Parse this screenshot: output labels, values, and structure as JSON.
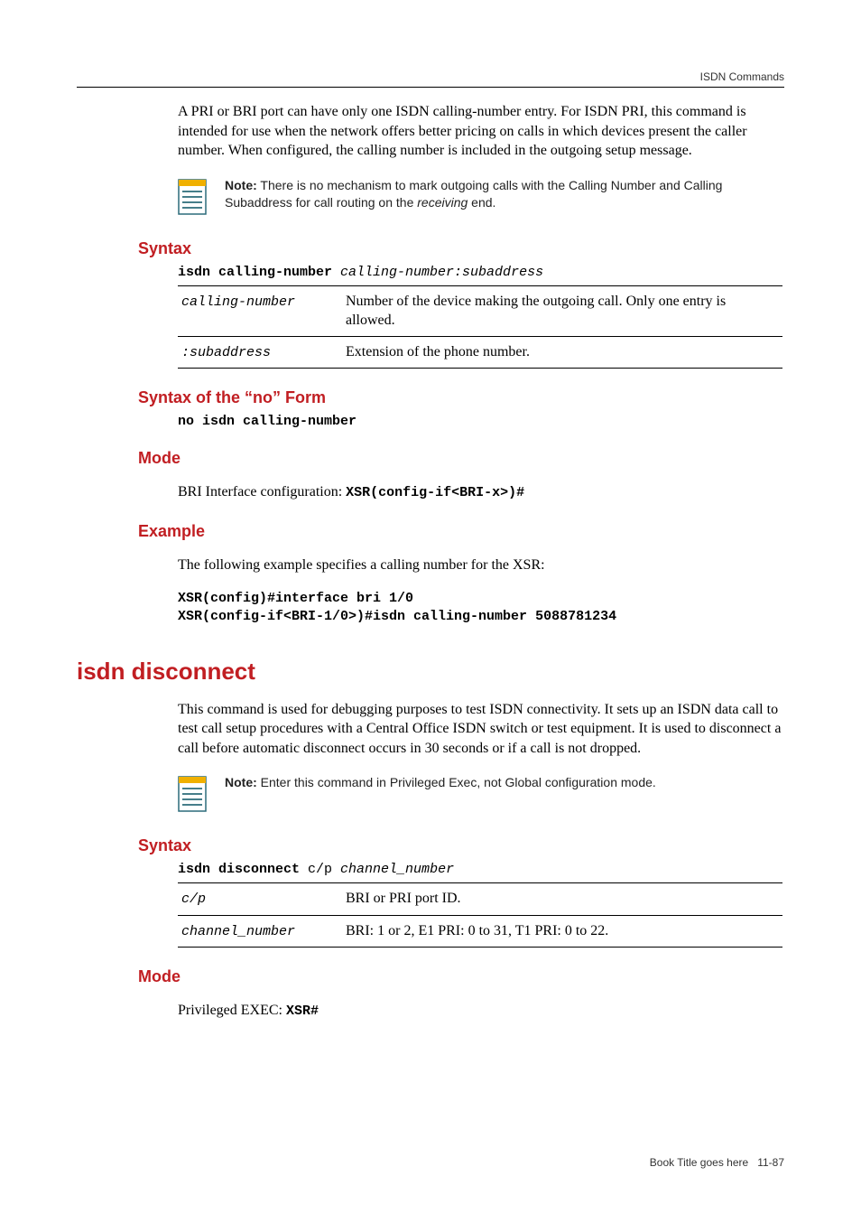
{
  "header": {
    "running": "ISDN Commands"
  },
  "intro": {
    "para": "A PRI or BRI port can have only one ISDN calling-number entry. For ISDN PRI, this command is intended for use when the network offers better pricing on calls in which devices present the caller number. When configured, the calling number is included in the outgoing setup message."
  },
  "note1": {
    "label": "Note:",
    "text_a": " There is no mechanism to mark outgoing calls with the Calling Number and Calling Subaddress for call routing on the ",
    "ital": "receiving",
    "text_b": " end."
  },
  "sec_syntax1": {
    "title": "Syntax",
    "cmd_bold": "isdn calling-number",
    "cmd_ital": " calling-number:subaddress",
    "rows": [
      {
        "key": "calling-number",
        "desc": "Number of the device making the outgoing call. Only one entry is allowed."
      },
      {
        "key": ":subaddress",
        "desc": "Extension of the phone number."
      }
    ]
  },
  "sec_noform": {
    "title": "Syntax of the “no” Form",
    "code": "no isdn calling-number"
  },
  "sec_mode1": {
    "title": "Mode",
    "text": "BRI Interface configuration: ",
    "code": "XSR(config-if<BRI-x>)#"
  },
  "sec_example": {
    "title": "Example",
    "text": "The following example specifies a calling number for the XSR:",
    "code": "XSR(config)#interface bri 1/0\nXSR(config-if<BRI-1/0>)#isdn calling-number 5088781234"
  },
  "cmd2": {
    "title": "isdn disconnect",
    "para": "This command is used for debugging purposes to test ISDN connectivity. It sets up an ISDN data call to test call setup procedures with a Central Office ISDN switch or test equipment. It is used to disconnect a call before automatic disconnect occurs in 30 seconds or if a call is not dropped."
  },
  "note2": {
    "label": "Note:",
    "text": " Enter this command in Privileged Exec, not Global configuration mode."
  },
  "sec_syntax2": {
    "title": "Syntax",
    "cmd_bold": "isdn disconnect",
    "cmd_plain": " c/p ",
    "cmd_ital": "channel_number",
    "rows": [
      {
        "key": "c/p",
        "desc": "BRI or PRI port ID."
      },
      {
        "key": "channel_number",
        "desc": "BRI: 1 or 2, E1 PRI: 0 to 31, T1 PRI: 0 to 22."
      }
    ]
  },
  "sec_mode2": {
    "title": "Mode",
    "text": "Privileged EXEC: ",
    "code": "XSR#"
  },
  "footer": {
    "book": "Book Title goes here",
    "page": "11-87"
  }
}
